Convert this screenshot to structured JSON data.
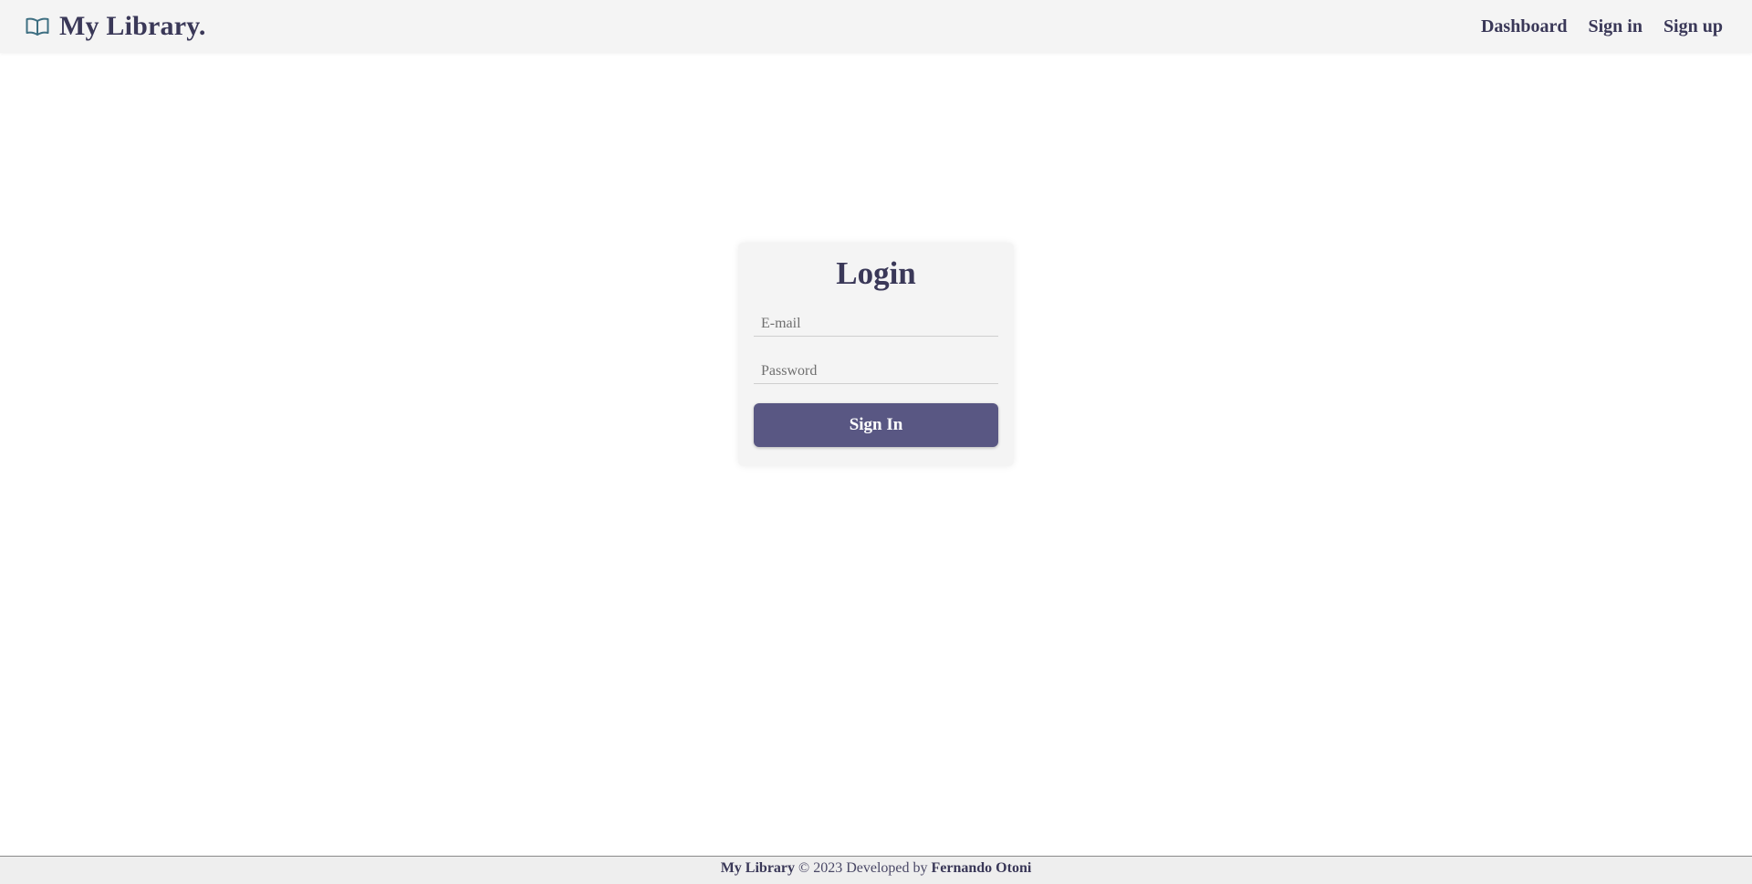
{
  "header": {
    "brand": "My Library.",
    "brand_icon": "open-book-icon",
    "nav": [
      {
        "label": "Dashboard"
      },
      {
        "label": "Sign in"
      },
      {
        "label": "Sign up"
      }
    ]
  },
  "login": {
    "title": "Login",
    "email_placeholder": "E-mail",
    "password_placeholder": "Password",
    "submit_label": "Sign In"
  },
  "footer": {
    "app_name": "My Library",
    "copyright": " © 2023 Developed by ",
    "author": "Fernando Otoni"
  },
  "colors": {
    "text": "#3a3858",
    "button": "#595783",
    "header_bg": "#f4f4f4",
    "icon": "#3e6f82"
  }
}
